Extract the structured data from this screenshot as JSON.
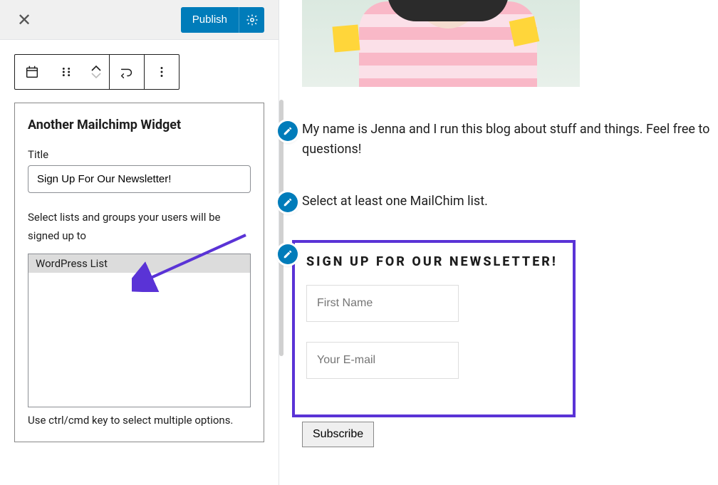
{
  "editor": {
    "publish_label": "Publish",
    "widget_block": {
      "heading": "Another Mailchimp Widget",
      "title_label": "Title",
      "title_value": "Sign Up For Our Newsletter!",
      "list_select_label": "Select lists and groups your users will be signed up to",
      "list_options": [
        "WordPress List"
      ],
      "hint": "Use ctrl/cmd key to select multiple options."
    }
  },
  "preview": {
    "about_text": "My name is Jenna and I run this blog about stuff and things. Feel free to questions!",
    "warning_text": "Select at least one MailChim list.",
    "form": {
      "heading": "SIGN UP FOR OUR NEWSLETTER!",
      "first_name_placeholder": "First Name",
      "email_placeholder": "Your E-mail",
      "subscribe_label": "Subscribe"
    }
  },
  "icons": {
    "close": "close-icon",
    "gear": "gear-icon",
    "calendar": "calendar-icon",
    "drag": "drag-icon",
    "chevron_up": "chevron-up-icon",
    "chevron_down": "chevron-down-icon",
    "undo": "undo-icon",
    "more": "more-icon",
    "pencil": "pencil-icon"
  },
  "annotations": {
    "arrow_color": "#5a33d6",
    "highlight_color": "#5a33d6"
  }
}
